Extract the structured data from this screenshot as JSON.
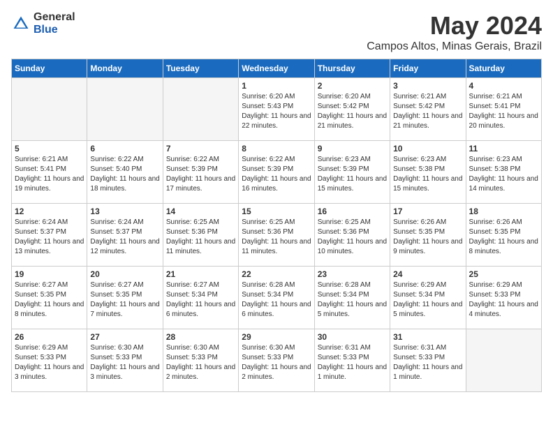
{
  "logo": {
    "general": "General",
    "blue": "Blue"
  },
  "title": "May 2024",
  "location": "Campos Altos, Minas Gerais, Brazil",
  "days_of_week": [
    "Sunday",
    "Monday",
    "Tuesday",
    "Wednesday",
    "Thursday",
    "Friday",
    "Saturday"
  ],
  "weeks": [
    [
      {
        "day": "",
        "sunrise": "",
        "sunset": "",
        "daylight": ""
      },
      {
        "day": "",
        "sunrise": "",
        "sunset": "",
        "daylight": ""
      },
      {
        "day": "",
        "sunrise": "",
        "sunset": "",
        "daylight": ""
      },
      {
        "day": "1",
        "sunrise": "Sunrise: 6:20 AM",
        "sunset": "Sunset: 5:43 PM",
        "daylight": "Daylight: 11 hours and 22 minutes."
      },
      {
        "day": "2",
        "sunrise": "Sunrise: 6:20 AM",
        "sunset": "Sunset: 5:42 PM",
        "daylight": "Daylight: 11 hours and 21 minutes."
      },
      {
        "day": "3",
        "sunrise": "Sunrise: 6:21 AM",
        "sunset": "Sunset: 5:42 PM",
        "daylight": "Daylight: 11 hours and 21 minutes."
      },
      {
        "day": "4",
        "sunrise": "Sunrise: 6:21 AM",
        "sunset": "Sunset: 5:41 PM",
        "daylight": "Daylight: 11 hours and 20 minutes."
      }
    ],
    [
      {
        "day": "5",
        "sunrise": "Sunrise: 6:21 AM",
        "sunset": "Sunset: 5:41 PM",
        "daylight": "Daylight: 11 hours and 19 minutes."
      },
      {
        "day": "6",
        "sunrise": "Sunrise: 6:22 AM",
        "sunset": "Sunset: 5:40 PM",
        "daylight": "Daylight: 11 hours and 18 minutes."
      },
      {
        "day": "7",
        "sunrise": "Sunrise: 6:22 AM",
        "sunset": "Sunset: 5:39 PM",
        "daylight": "Daylight: 11 hours and 17 minutes."
      },
      {
        "day": "8",
        "sunrise": "Sunrise: 6:22 AM",
        "sunset": "Sunset: 5:39 PM",
        "daylight": "Daylight: 11 hours and 16 minutes."
      },
      {
        "day": "9",
        "sunrise": "Sunrise: 6:23 AM",
        "sunset": "Sunset: 5:39 PM",
        "daylight": "Daylight: 11 hours and 15 minutes."
      },
      {
        "day": "10",
        "sunrise": "Sunrise: 6:23 AM",
        "sunset": "Sunset: 5:38 PM",
        "daylight": "Daylight: 11 hours and 15 minutes."
      },
      {
        "day": "11",
        "sunrise": "Sunrise: 6:23 AM",
        "sunset": "Sunset: 5:38 PM",
        "daylight": "Daylight: 11 hours and 14 minutes."
      }
    ],
    [
      {
        "day": "12",
        "sunrise": "Sunrise: 6:24 AM",
        "sunset": "Sunset: 5:37 PM",
        "daylight": "Daylight: 11 hours and 13 minutes."
      },
      {
        "day": "13",
        "sunrise": "Sunrise: 6:24 AM",
        "sunset": "Sunset: 5:37 PM",
        "daylight": "Daylight: 11 hours and 12 minutes."
      },
      {
        "day": "14",
        "sunrise": "Sunrise: 6:25 AM",
        "sunset": "Sunset: 5:36 PM",
        "daylight": "Daylight: 11 hours and 11 minutes."
      },
      {
        "day": "15",
        "sunrise": "Sunrise: 6:25 AM",
        "sunset": "Sunset: 5:36 PM",
        "daylight": "Daylight: 11 hours and 11 minutes."
      },
      {
        "day": "16",
        "sunrise": "Sunrise: 6:25 AM",
        "sunset": "Sunset: 5:36 PM",
        "daylight": "Daylight: 11 hours and 10 minutes."
      },
      {
        "day": "17",
        "sunrise": "Sunrise: 6:26 AM",
        "sunset": "Sunset: 5:35 PM",
        "daylight": "Daylight: 11 hours and 9 minutes."
      },
      {
        "day": "18",
        "sunrise": "Sunrise: 6:26 AM",
        "sunset": "Sunset: 5:35 PM",
        "daylight": "Daylight: 11 hours and 8 minutes."
      }
    ],
    [
      {
        "day": "19",
        "sunrise": "Sunrise: 6:27 AM",
        "sunset": "Sunset: 5:35 PM",
        "daylight": "Daylight: 11 hours and 8 minutes."
      },
      {
        "day": "20",
        "sunrise": "Sunrise: 6:27 AM",
        "sunset": "Sunset: 5:35 PM",
        "daylight": "Daylight: 11 hours and 7 minutes."
      },
      {
        "day": "21",
        "sunrise": "Sunrise: 6:27 AM",
        "sunset": "Sunset: 5:34 PM",
        "daylight": "Daylight: 11 hours and 6 minutes."
      },
      {
        "day": "22",
        "sunrise": "Sunrise: 6:28 AM",
        "sunset": "Sunset: 5:34 PM",
        "daylight": "Daylight: 11 hours and 6 minutes."
      },
      {
        "day": "23",
        "sunrise": "Sunrise: 6:28 AM",
        "sunset": "Sunset: 5:34 PM",
        "daylight": "Daylight: 11 hours and 5 minutes."
      },
      {
        "day": "24",
        "sunrise": "Sunrise: 6:29 AM",
        "sunset": "Sunset: 5:34 PM",
        "daylight": "Daylight: 11 hours and 5 minutes."
      },
      {
        "day": "25",
        "sunrise": "Sunrise: 6:29 AM",
        "sunset": "Sunset: 5:33 PM",
        "daylight": "Daylight: 11 hours and 4 minutes."
      }
    ],
    [
      {
        "day": "26",
        "sunrise": "Sunrise: 6:29 AM",
        "sunset": "Sunset: 5:33 PM",
        "daylight": "Daylight: 11 hours and 3 minutes."
      },
      {
        "day": "27",
        "sunrise": "Sunrise: 6:30 AM",
        "sunset": "Sunset: 5:33 PM",
        "daylight": "Daylight: 11 hours and 3 minutes."
      },
      {
        "day": "28",
        "sunrise": "Sunrise: 6:30 AM",
        "sunset": "Sunset: 5:33 PM",
        "daylight": "Daylight: 11 hours and 2 minutes."
      },
      {
        "day": "29",
        "sunrise": "Sunrise: 6:30 AM",
        "sunset": "Sunset: 5:33 PM",
        "daylight": "Daylight: 11 hours and 2 minutes."
      },
      {
        "day": "30",
        "sunrise": "Sunrise: 6:31 AM",
        "sunset": "Sunset: 5:33 PM",
        "daylight": "Daylight: 11 hours and 1 minute."
      },
      {
        "day": "31",
        "sunrise": "Sunrise: 6:31 AM",
        "sunset": "Sunset: 5:33 PM",
        "daylight": "Daylight: 11 hours and 1 minute."
      },
      {
        "day": "",
        "sunrise": "",
        "sunset": "",
        "daylight": ""
      }
    ]
  ]
}
